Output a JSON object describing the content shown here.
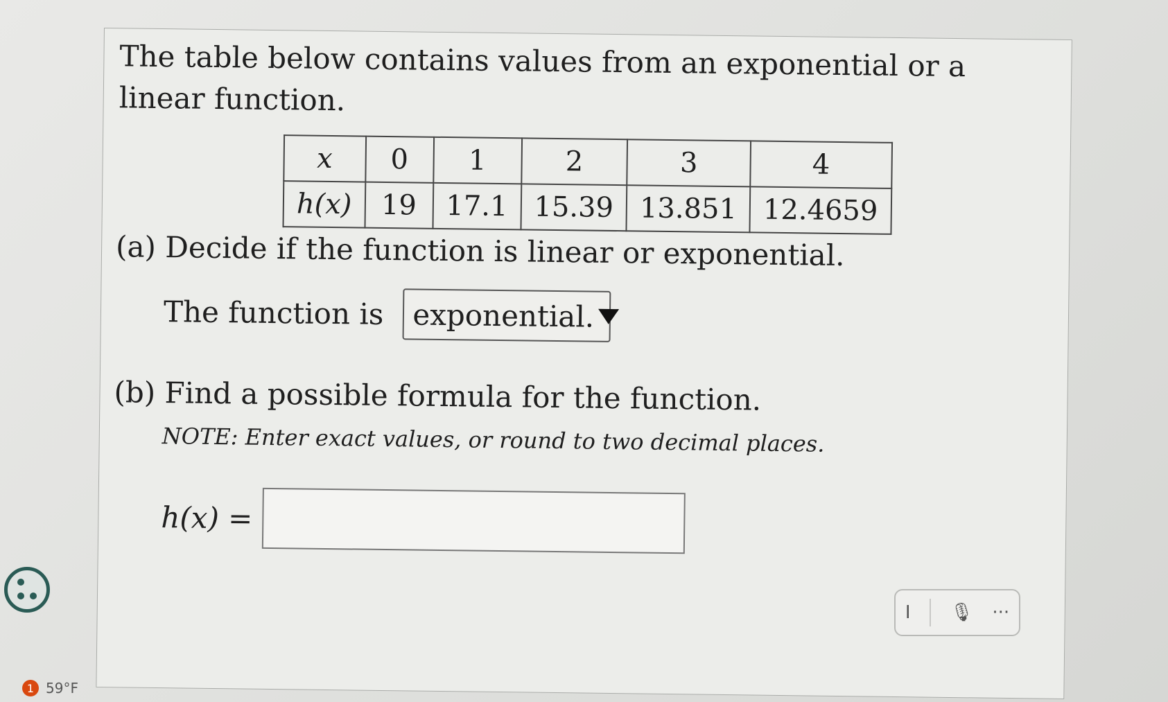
{
  "intro": "The table below contains values from an exponential or a linear function.",
  "table": {
    "row1_label": "x",
    "row2_label": "h(x)",
    "x": [
      "0",
      "1",
      "2",
      "3",
      "4"
    ],
    "h": [
      "19",
      "17.1",
      "15.39",
      "13.851",
      "12.4659"
    ]
  },
  "part_a": {
    "question": "(a) Decide if the function is linear or exponential.",
    "prefix": "The function is",
    "selected": "exponential."
  },
  "part_b": {
    "question": "(b) Find a possible formula for the function.",
    "note": "NOTE: Enter exact values, or round to two decimal places.",
    "label": "h(x) =",
    "value": ""
  },
  "toolbar": {
    "cursor_icon": "text-cursor-icon",
    "mic_icon": "microphone-icon",
    "more": "···"
  },
  "status": {
    "badge": "1",
    "weather": "59°F"
  }
}
